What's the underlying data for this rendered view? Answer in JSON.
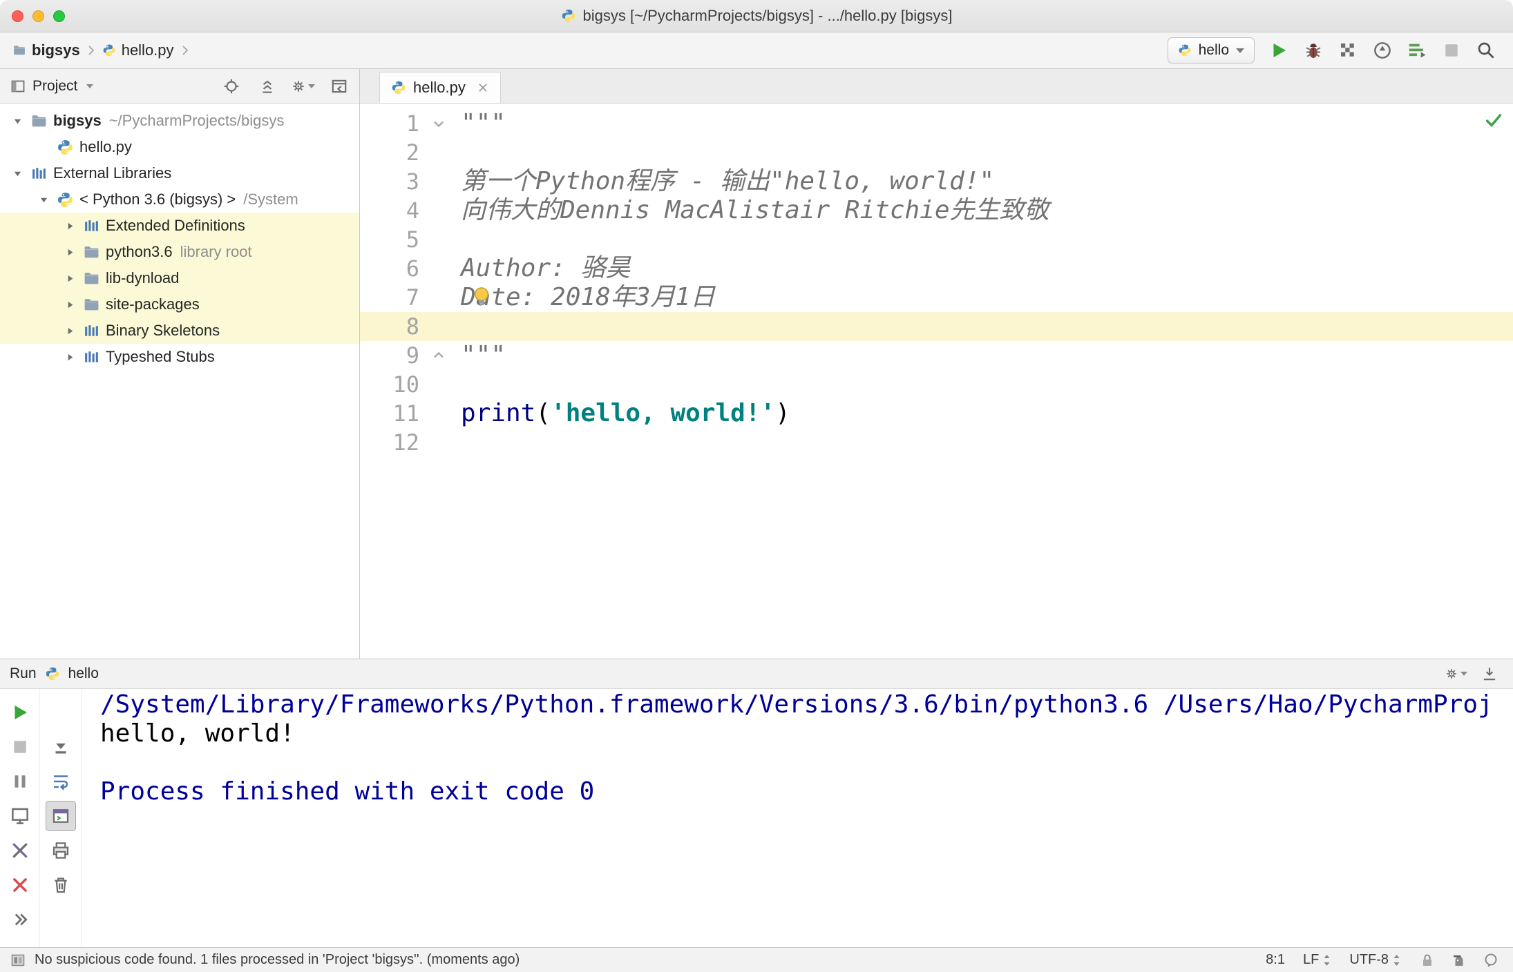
{
  "window": {
    "title": "bigsys [~/PycharmProjects/bigsys] - .../hello.py [bigsys]"
  },
  "navbar": {
    "breadcrumbs": [
      {
        "label": "bigsys",
        "icon": "folder-icon",
        "bold": true
      },
      {
        "label": "hello.py",
        "icon": "python-icon",
        "bold": false
      }
    ],
    "run_config": {
      "label": "hello",
      "icon": "python-icon"
    },
    "actions": [
      {
        "name": "run-button",
        "icon": "run-icon"
      },
      {
        "name": "debug-button",
        "icon": "debug-icon"
      },
      {
        "name": "coverage-button",
        "icon": "coverage-icon"
      },
      {
        "name": "profiler-button",
        "icon": "profiler-icon"
      },
      {
        "name": "concurrency-button",
        "icon": "concurrency-icon"
      },
      {
        "name": "stop-button",
        "icon": "stop-disabled-icon"
      },
      {
        "name": "search-everywhere-button",
        "icon": "search-icon"
      }
    ]
  },
  "project_panel": {
    "title": "Project",
    "actions": [
      {
        "name": "locate-button",
        "icon": "locate-icon"
      },
      {
        "name": "collapse-all-button",
        "icon": "collapse-all-icon"
      },
      {
        "name": "settings-button",
        "icon": "gear-icon",
        "dropdown": true
      },
      {
        "name": "hide-panel-button",
        "icon": "hide-icon"
      }
    ],
    "tree": [
      {
        "indent": 0,
        "arrow": "down",
        "icon": "folder-icon",
        "label": "bigsys",
        "bold": true,
        "suffix": "~/PycharmProjects/bigsys"
      },
      {
        "indent": 1,
        "arrow": "none",
        "icon": "python-icon",
        "label": "hello.py"
      },
      {
        "indent": 0,
        "arrow": "down",
        "icon": "library-icon",
        "label": "External Libraries"
      },
      {
        "indent": 1,
        "arrow": "down",
        "icon": "python-icon",
        "label": "< Python 3.6 (bigsys) >",
        "suffix": "/System"
      },
      {
        "indent": 2,
        "arrow": "right",
        "icon": "library-icon",
        "label": "Extended Definitions",
        "highlight": true
      },
      {
        "indent": 2,
        "arrow": "right",
        "icon": "folder-icon",
        "label": "python3.6",
        "suffix": "library root",
        "highlight": true
      },
      {
        "indent": 2,
        "arrow": "right",
        "icon": "folder-icon",
        "label": "lib-dynload",
        "highlight": true
      },
      {
        "indent": 2,
        "arrow": "right",
        "icon": "folder-icon",
        "label": "site-packages",
        "highlight": true
      },
      {
        "indent": 2,
        "arrow": "right",
        "icon": "library-icon",
        "label": "Binary Skeletons",
        "highlight": true
      },
      {
        "indent": 2,
        "arrow": "right",
        "icon": "library-icon",
        "label": "Typeshed Stubs"
      }
    ]
  },
  "editor": {
    "tab": {
      "label": "hello.py",
      "icon": "python-icon"
    },
    "lines": [
      {
        "n": "1",
        "fold": "start",
        "segs": [
          {
            "t": "\"\"\"",
            "s": "doc"
          }
        ]
      },
      {
        "n": "2",
        "segs": []
      },
      {
        "n": "3",
        "segs": [
          {
            "t": "第一个Python程序 - 输出\"hello, world!\"",
            "s": "doc"
          }
        ]
      },
      {
        "n": "4",
        "segs": [
          {
            "t": "向伟大的Dennis MacAlistair Ritchie先生致敬",
            "s": "doc"
          }
        ]
      },
      {
        "n": "5",
        "segs": []
      },
      {
        "n": "6",
        "segs": [
          {
            "t": "Author: 骆昊",
            "s": "doc"
          }
        ]
      },
      {
        "n": "7",
        "segs": [
          {
            "t": "Date: 2018年3月1日",
            "s": "doc"
          }
        ]
      },
      {
        "n": "8",
        "current": true,
        "segs": []
      },
      {
        "n": "9",
        "fold": "end",
        "segs": [
          {
            "t": "\"\"\"",
            "s": "doc"
          }
        ]
      },
      {
        "n": "10",
        "segs": []
      },
      {
        "n": "11",
        "segs": [
          {
            "t": "print",
            "s": "kw"
          },
          {
            "t": "(",
            "s": "plain"
          },
          {
            "t": "'hello, world!'",
            "s": "str"
          },
          {
            "t": ")",
            "s": "plain"
          }
        ]
      },
      {
        "n": "12",
        "segs": []
      }
    ]
  },
  "run_panel": {
    "title": "Run",
    "config": {
      "label": "hello",
      "icon": "python-icon"
    },
    "header_actions": [
      {
        "name": "run-settings-button",
        "icon": "gear-icon",
        "dropdown": true
      },
      {
        "name": "dock-button",
        "icon": "dock-icon"
      }
    ],
    "left_toolbar": [
      {
        "name": "rerun-button",
        "icon": "run-icon"
      },
      {
        "name": "stop-button",
        "icon": "stop-disabled-icon"
      },
      {
        "name": "pause-output-button",
        "icon": "pause-icon"
      },
      {
        "name": "restore-layout-button",
        "icon": "restore-layout-icon"
      },
      {
        "name": "edit-configurations-button",
        "icon": "tools-icon"
      },
      {
        "name": "close-button",
        "icon": "close-red-icon"
      },
      {
        "name": "hide-toolbar-button",
        "icon": "chevrons-icon"
      }
    ],
    "console_toolbar": [
      {
        "name": "scroll-to-end-button",
        "icon": "scroll-end-icon"
      },
      {
        "name": "soft-wrap-button",
        "icon": "soft-wrap-icon"
      },
      {
        "name": "show-console-button",
        "icon": "console-icon",
        "active": true
      },
      {
        "name": "print-button",
        "icon": "print-icon"
      },
      {
        "name": "clear-all-button",
        "icon": "clear-icon"
      }
    ],
    "output": [
      {
        "text": "/System/Library/Frameworks/Python.framework/Versions/3.6/bin/python3.6 /Users/Hao/PycharmProj",
        "style": "system"
      },
      {
        "text": "hello, world!",
        "style": "stdout"
      },
      {
        "text": "",
        "style": "stdout"
      },
      {
        "text": "Process finished with exit code 0",
        "style": "system"
      }
    ]
  },
  "statusbar": {
    "message": "No suspicious code found. 1 files processed in 'Project 'bigsys''. (moments ago)",
    "caret_position": "8:1",
    "line_separator": "LF",
    "encoding": "UTF-8",
    "icons": [
      {
        "name": "readonly-lock-icon",
        "icon": "lock-icon"
      },
      {
        "name": "hector-inspector-icon",
        "icon": "hector-icon"
      },
      {
        "name": "event-log-icon",
        "icon": "bubble-icon"
      }
    ]
  },
  "colors": {
    "traffic_red": "#ff5f57",
    "traffic_yellow": "#febc2e",
    "traffic_green": "#28c840",
    "run_green": "#3aa63a",
    "keyword_navy": "#000080",
    "string_teal": "#008080",
    "console_system_blue": "#000099",
    "current_line_yellow": "#fbf5d0",
    "library_highlight_yellow": "#fbf9d6"
  }
}
